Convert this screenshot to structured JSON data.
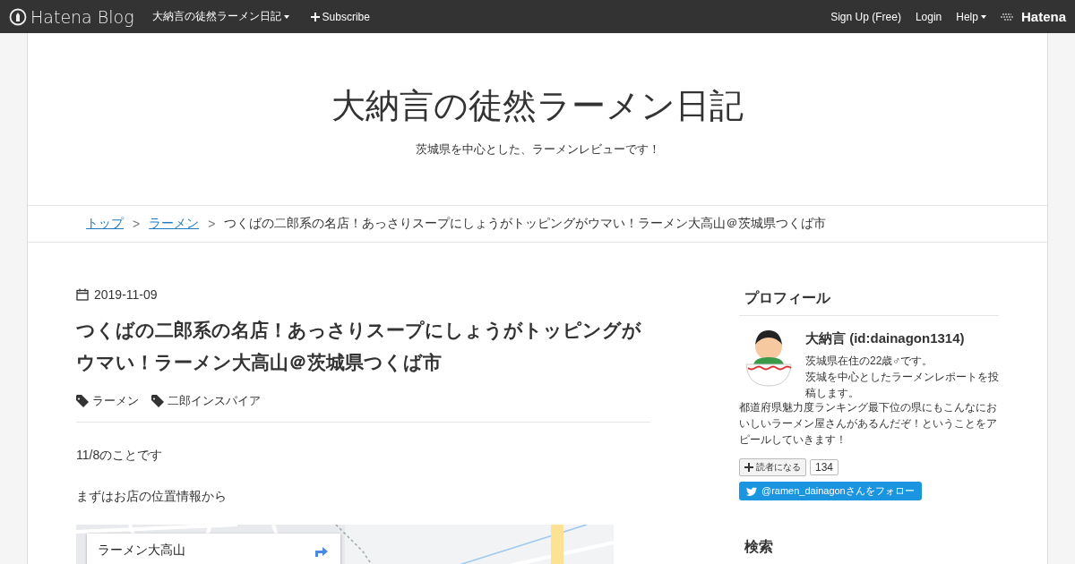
{
  "top_bar": {
    "logo": "Hatena Blog",
    "blog_menu": "大納言の徒然ラーメン日記",
    "subscribe": "Subscribe",
    "links": [
      "Sign Up (Free)",
      "Login",
      "Help"
    ],
    "brand": "Hatena"
  },
  "header": {
    "title": "大納言の徒然ラーメン日記",
    "description": "茨城県を中心とした、ラーメンレビューです！"
  },
  "breadcrumb": [
    {
      "label": "トップ",
      "kind": "link"
    },
    {
      "label": ">",
      "kind": "separator"
    },
    {
      "label": "ラーメン",
      "kind": "link"
    },
    {
      "label": ">",
      "kind": "separator"
    },
    {
      "label": "つくばの二郎系の名店！あっさりスープにしょうがトッピングがウマい！ラーメン大高山＠茨城県つくば市",
      "kind": "current"
    }
  ],
  "article": {
    "date": "2019-11-09",
    "title": "つくばの二郎系の名店！あっさりスープにしょうがトッピングがウマい！ラーメン大高山＠茨城県つくば市",
    "categories": [
      "ラーメン",
      "二郎インスパイア"
    ],
    "paragraphs": [
      "11/8のことです",
      "まずはお店の位置情報から"
    ],
    "map": {
      "place_name": "ラーメン大高山"
    }
  },
  "sidebar": {
    "profile": {
      "heading": "プロフィール",
      "name": "大納言 (id:dainagon1314)",
      "bio": [
        "茨城県在住の22歳♂です。",
        "茨城を中心としたラーメンレポートを投稿します。"
      ],
      "about": "都道府県魅力度ランキング最下位の県にもこんなにおいしいラーメン屋さんがあるんだぞ！ということをアピールしていきます！",
      "subscribe_button": "読者になる",
      "subscriber_count": "134",
      "twitter_follow": "@ramen_dainagonさんをフォロー"
    },
    "search_heading": "検索"
  }
}
